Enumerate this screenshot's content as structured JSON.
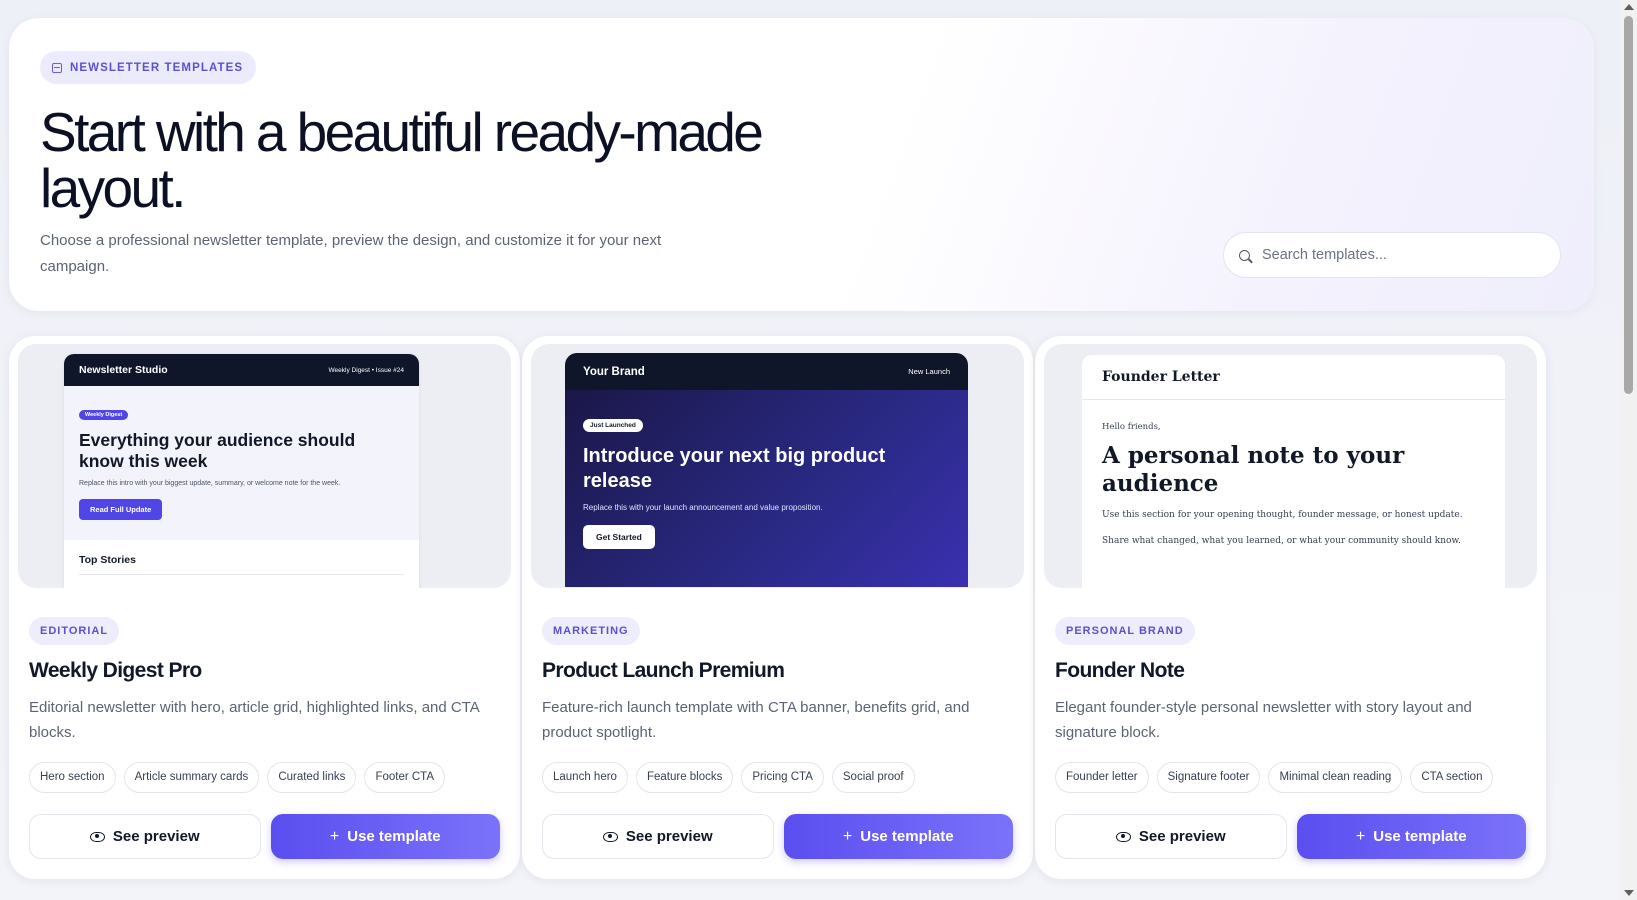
{
  "hero": {
    "badge_label": "NEWSLETTER TEMPLATES",
    "title": "Start with a beautiful ready-made layout.",
    "subtitle": "Choose a professional newsletter template, preview the design, and customize it for your next campaign.",
    "search_placeholder": "Search templates..."
  },
  "cards": [
    {
      "category": "EDITORIAL",
      "title": "Weekly Digest Pro",
      "description": "Editorial newsletter with hero, article grid, highlighted links, and CTA blocks.",
      "features": [
        "Hero section",
        "Article summary cards",
        "Curated links",
        "Footer CTA"
      ],
      "preview_button": "See preview",
      "use_button": "Use template",
      "mock": {
        "brand": "Newsletter Studio",
        "meta": "Weekly Digest • Issue #24",
        "pill": "Weekly Digest",
        "heading": "Everything your audience should know this week",
        "body": "Replace this intro with your biggest update, summary, or welcome note for the week.",
        "cta": "Read Full Update",
        "section": "Top Stories"
      }
    },
    {
      "category": "MARKETING",
      "title": "Product Launch Premium",
      "description": "Feature-rich launch template with CTA banner, benefits grid, and product spotlight.",
      "features": [
        "Launch hero",
        "Feature blocks",
        "Pricing CTA",
        "Social proof"
      ],
      "preview_button": "See preview",
      "use_button": "Use template",
      "mock": {
        "brand": "Your Brand",
        "meta": "New Launch",
        "pill": "Just Launched",
        "heading": "Introduce your next big product release",
        "body": "Replace this with your launch announcement and value proposition.",
        "cta": "Get Started"
      }
    },
    {
      "category": "PERSONAL BRAND",
      "title": "Founder Note",
      "description": "Elegant founder-style personal newsletter with story layout and signature block.",
      "features": [
        "Founder letter",
        "Signature footer",
        "Minimal clean reading",
        "CTA section"
      ],
      "preview_button": "See preview",
      "use_button": "Use template",
      "mock": {
        "brand": "Founder Letter",
        "greeting": "Hello friends,",
        "heading": "A personal note to your audience",
        "body1": "Use this section for your opening thought, founder message, or honest update.",
        "body2": "Share what changed, what you learned, or what your community should know."
      }
    }
  ],
  "colors": {
    "accent": "#5b4ef0",
    "accent_light": "#eeedfc",
    "dark_navy": "#0f1629"
  }
}
